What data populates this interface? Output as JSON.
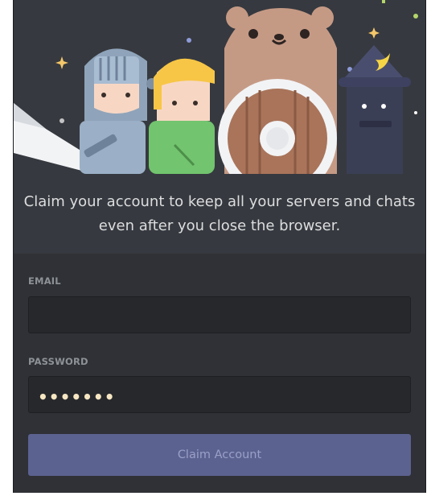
{
  "hero": {
    "description": "Claim your account to keep all your servers and chats even after you close the browser."
  },
  "form": {
    "email_label": "EMAIL",
    "email_value": "",
    "password_label": "PASSWORD",
    "password_display": "•••••••",
    "submit_label": "Claim Account"
  },
  "colors": {
    "background": "#2f3136",
    "hero_background": "#36393f",
    "button": "#5b6290"
  }
}
